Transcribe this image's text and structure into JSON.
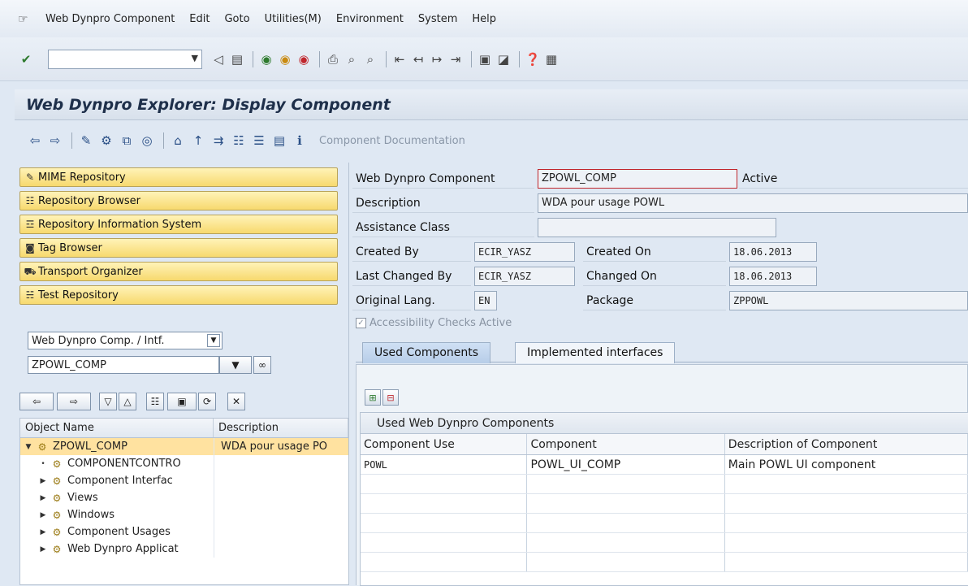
{
  "menubar": {
    "items": [
      {
        "label": "Web Dynpro Component"
      },
      {
        "label": "Edit"
      },
      {
        "label": "Goto"
      },
      {
        "label": "Utilities(M)"
      },
      {
        "label": "Environment"
      },
      {
        "label": "System"
      },
      {
        "label": "Help"
      }
    ]
  },
  "toolbar": {
    "command_value": "",
    "icons": [
      "enter-icon",
      "back-icon",
      "save-icon",
      "back-nav-icon",
      "exit-icon",
      "cancel-icon",
      "print-icon",
      "find-icon",
      "find-next-icon",
      "first-page-icon",
      "prev-page-icon",
      "next-page-icon",
      "last-page-icon",
      "new-session-icon",
      "shortcut-icon",
      "help-icon",
      "customize-icon"
    ]
  },
  "screen": {
    "title": "Web Dynpro Explorer: Display Component"
  },
  "app_toolbar": {
    "doc_label": "Component Documentation"
  },
  "nav_buttons": [
    {
      "label": "MIME Repository",
      "icon": "mime-icon"
    },
    {
      "label": "Repository Browser",
      "icon": "hierarchy-icon"
    },
    {
      "label": "Repository Information System",
      "icon": "info-system-icon"
    },
    {
      "label": "Tag Browser",
      "icon": "tag-icon"
    },
    {
      "label": "Transport Organizer",
      "icon": "truck-icon"
    },
    {
      "label": "Test Repository",
      "icon": "test-icon"
    }
  ],
  "object_selector": {
    "type_value": "Web Dynpro Comp. / Intf.",
    "name_value": "ZPOWL_COMP"
  },
  "tree": {
    "col_object": "Object Name",
    "col_desc": "Description",
    "rows": [
      {
        "name": "ZPOWL_COMP",
        "desc": "WDA pour usage PO",
        "twisty": "▼",
        "level": 0
      },
      {
        "name": "COMPONENTCONTRO",
        "desc": "",
        "twisty": "•",
        "level": 1
      },
      {
        "name": "Component Interfac",
        "desc": "",
        "twisty": "▶",
        "level": 1
      },
      {
        "name": "Views",
        "desc": "",
        "twisty": "▶",
        "level": 1
      },
      {
        "name": "Windows",
        "desc": "",
        "twisty": "▶",
        "level": 1
      },
      {
        "name": "Component Usages",
        "desc": "",
        "twisty": "▶",
        "level": 1
      },
      {
        "name": "Web Dynpro Applicat",
        "desc": "",
        "twisty": "▶",
        "level": 1
      }
    ]
  },
  "form": {
    "component_label": "Web Dynpro Component",
    "component_value": "ZPOWL_COMP",
    "status": "Active",
    "description_label": "Description",
    "description_value": "WDA pour usage POWL",
    "assistance_label": "Assistance Class",
    "assistance_value": "",
    "created_by_label": "Created By",
    "created_by_value": "ECIR_YASZ",
    "created_on_label": "Created On",
    "created_on_value": "18.06.2013",
    "changed_by_label": "Last Changed By",
    "changed_by_value": "ECIR_YASZ",
    "changed_on_label": "Changed On",
    "changed_on_value": "18.06.2013",
    "lang_label": "Original Lang.",
    "lang_value": "EN",
    "package_label": "Package",
    "package_value": "ZPPOWL",
    "accessibility_label": "Accessibility Checks Active",
    "accessibility_checked": true
  },
  "tabs": [
    {
      "label": "Used Components",
      "active": true
    },
    {
      "label": "Implemented interfaces",
      "active": false
    }
  ],
  "used_components": {
    "title": "Used Web Dynpro Components",
    "columns": [
      "Component Use",
      "Component",
      "Description of Component"
    ],
    "rows": [
      [
        "POWL",
        "POWL_UI_COMP",
        "Main POWL UI component"
      ]
    ]
  }
}
